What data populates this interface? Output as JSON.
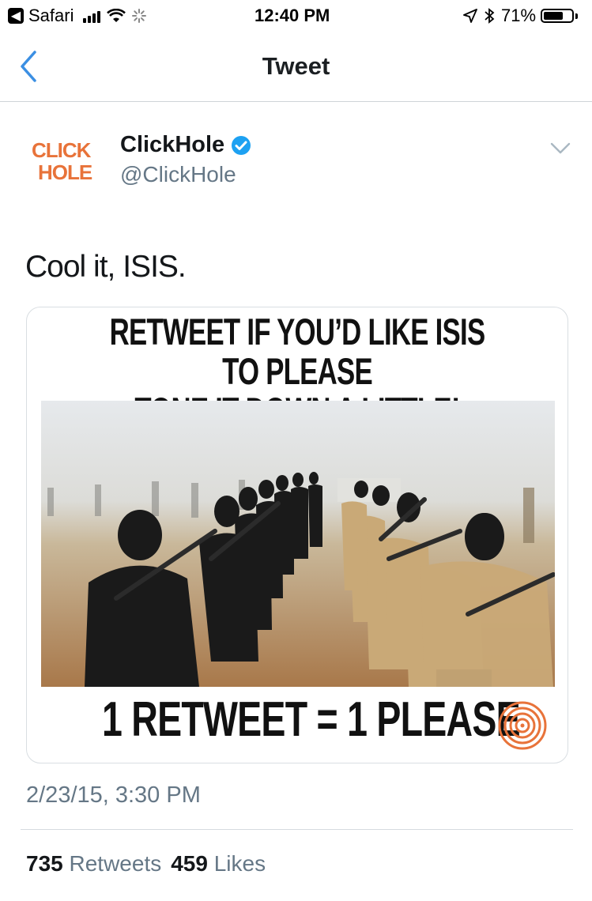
{
  "status_bar": {
    "back_app": "Safari",
    "time": "12:40 PM",
    "battery": "71%",
    "battery_level": 0.71
  },
  "nav": {
    "title": "Tweet"
  },
  "tweet": {
    "avatar_text_line1": "CLICK",
    "avatar_text_line2": "HOLE",
    "display_name": "ClickHole",
    "handle": "@ClickHole",
    "text": "Cool it, ISIS.",
    "timestamp": "2/23/15, 3:30 PM"
  },
  "media": {
    "headline_line1": "RETWEET IF YOU’D LIKE ISIS TO PLEASE",
    "headline_line2": "TONE IT DOWN A LITTLE!",
    "footer": "1 RETWEET = 1 PLEASE"
  },
  "stats": {
    "retweets_count": "735",
    "retweets_label": "Retweets",
    "likes_count": "459",
    "likes_label": "Likes"
  },
  "colors": {
    "accent": "#1da1f2",
    "nav_back": "#3b8fe3",
    "brand_orange": "#e8733a",
    "muted": "#657786"
  }
}
